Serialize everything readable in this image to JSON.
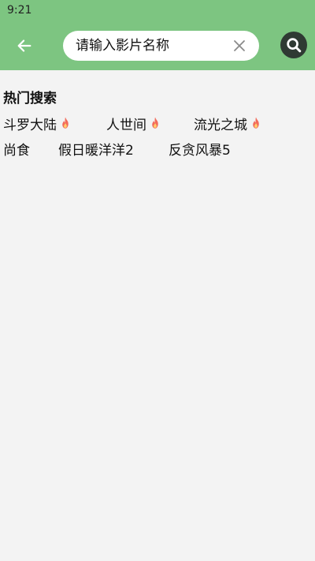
{
  "status_bar": {
    "time": "9:21"
  },
  "header": {
    "back_icon": "arrow-left-icon",
    "search": {
      "placeholder": "请输入影片名称",
      "value": ""
    },
    "clear_icon": "close-icon",
    "search_icon": "magnifier-icon"
  },
  "hot_search": {
    "title": "热门搜索",
    "rows": [
      [
        {
          "label": "斗罗大陆",
          "hot": true
        },
        {
          "label": "人世间",
          "hot": true
        },
        {
          "label": "流光之城",
          "hot": true
        }
      ],
      [
        {
          "label": "尚食",
          "hot": false
        },
        {
          "label": "假日暖洋洋2",
          "hot": false
        },
        {
          "label": "反贪风暴5",
          "hot": false
        }
      ]
    ]
  },
  "colors": {
    "header_bg": "#7dc581",
    "page_bg": "#f3f3f3",
    "search_button_bg": "#2f3a33",
    "flame": "#f26b5b"
  }
}
